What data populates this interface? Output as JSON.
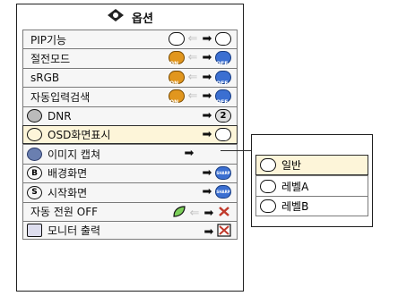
{
  "menu": {
    "title": "옵션",
    "title_icon": "options-icon",
    "items": [
      {
        "label": "PIP기능",
        "control": [
          "oval-white",
          "arrow-faint",
          "arrow",
          "oval-white"
        ]
      },
      {
        "label": "절전모드",
        "control": [
          "oval-orange-on",
          "arrow-faint",
          "arrow",
          "oval-blue-off"
        ]
      },
      {
        "label": "sRGB",
        "control": [
          "oval-orange-on",
          "arrow-faint",
          "arrow",
          "oval-blue-off"
        ]
      },
      {
        "label": "자동입력검색",
        "control": [
          "oval-orange-on",
          "arrow-faint",
          "arrow",
          "oval-blue-off"
        ]
      },
      {
        "label": "DNR",
        "lead_icon": "dnr-icon",
        "control": [
          "arrow",
          "oval-2"
        ]
      },
      {
        "label": "OSD화면표시",
        "lead_icon": "osd-icon",
        "highlighted": true,
        "control": [
          "arrow",
          "oval-white"
        ]
      },
      {
        "label": "이미지 캡쳐",
        "lead_icon": "image-capture-icon",
        "control": [
          "arrow"
        ]
      },
      {
        "label": "배경화면",
        "lead_icon": "background-b-icon",
        "control": [
          "arrow",
          "oval-sharp"
        ]
      },
      {
        "label": "시작화면",
        "lead_icon": "startup-s-icon",
        "control": [
          "arrow",
          "oval-sharp"
        ]
      },
      {
        "label": "자동 전원 OFF",
        "control": [
          "leaf",
          "arrow-faint",
          "arrow",
          "x-mark"
        ]
      },
      {
        "label": "모니터 출력",
        "lead_icon": "monitor-output-icon",
        "control": [
          "arrow",
          "boxed-x"
        ]
      }
    ]
  },
  "submenu": {
    "items": [
      {
        "label": "일반",
        "highlighted": true
      },
      {
        "label": "레벨A"
      },
      {
        "label": "레벨B"
      }
    ]
  },
  "dnr_value": "2",
  "sharp_text": "SHARP",
  "on_text": "ON",
  "off_text": "OFF"
}
